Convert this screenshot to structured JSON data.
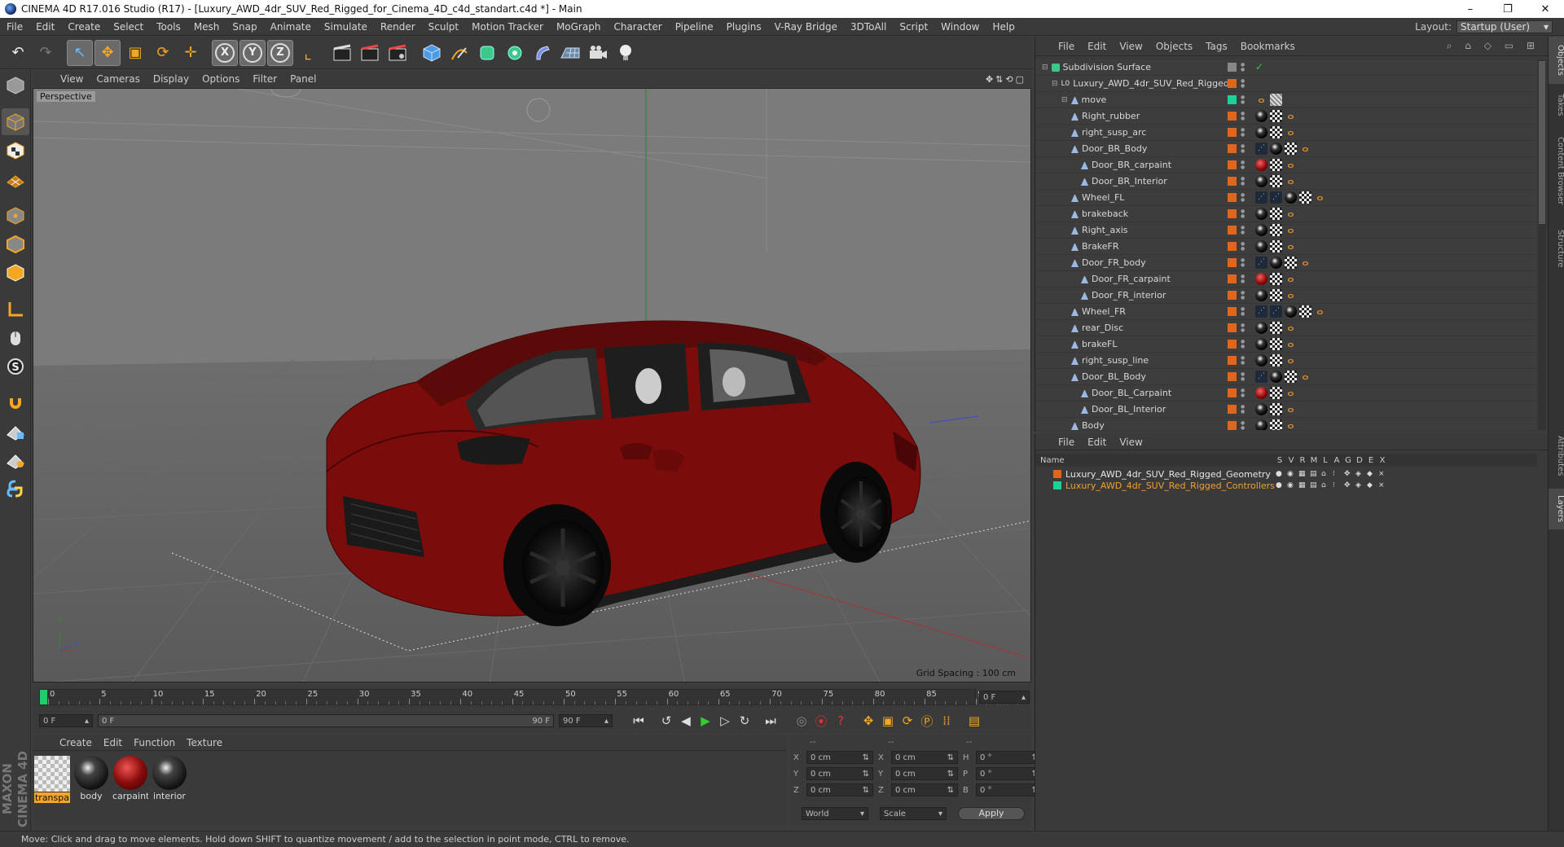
{
  "window": {
    "title": "CINEMA 4D R17.016 Studio (R17) - [Luxury_AWD_4dr_SUV_Red_Rigged_for_Cinema_4D_c4d_standart.c4d *] - Main",
    "min": "–",
    "max": "❐",
    "close": "✕"
  },
  "menu": {
    "items": [
      "File",
      "Edit",
      "Create",
      "Select",
      "Tools",
      "Mesh",
      "Snap",
      "Animate",
      "Simulate",
      "Render",
      "Sculpt",
      "Motion Tracker",
      "MoGraph",
      "Character",
      "Pipeline",
      "Plugins",
      "V-Ray Bridge",
      "3DToAll",
      "Script",
      "Window",
      "Help"
    ],
    "layout_label": "Layout:",
    "layout_value": "Startup (User)"
  },
  "toolbar": {
    "undo": "↶",
    "redo": "↷",
    "select": "↖",
    "move": "✥",
    "scale": "▣",
    "rotate": "⟳",
    "last": "✛",
    "x": "X",
    "y": "Y",
    "z": "Z",
    "coord": "⌞"
  },
  "viewport": {
    "menu": [
      "View",
      "Cameras",
      "Display",
      "Options",
      "Filter",
      "Panel"
    ],
    "nav_icons": "✥⇅⟲▢",
    "label": "Perspective",
    "grid_spacing": "Grid Spacing : 100 cm",
    "axis_y": "y",
    "axis_z": "z",
    "colors": {
      "car": "#7a0d0b",
      "bg": "#7a7a7a",
      "floor": "#5e5e5e"
    }
  },
  "timeline": {
    "ticks": [
      "0",
      "5",
      "10",
      "15",
      "20",
      "25",
      "30",
      "35",
      "40",
      "45",
      "50",
      "55",
      "60",
      "65",
      "70",
      "75",
      "80",
      "85",
      "90"
    ],
    "end_frame": "0 F",
    "current": "0 F",
    "range_start": "0 F",
    "range_end": "90 F",
    "max": "90 F"
  },
  "materials": {
    "menu": [
      "Create",
      "Edit",
      "Function",
      "Texture"
    ],
    "items": [
      {
        "label": "transpa",
        "kind": "checker"
      },
      {
        "label": "body",
        "kind": "dark"
      },
      {
        "label": "carpaint",
        "kind": "red"
      },
      {
        "label": "interior",
        "kind": "dark"
      }
    ]
  },
  "coords": {
    "header": [
      "--",
      "--",
      "--"
    ],
    "rows": [
      {
        "a": "X",
        "av": "0 cm",
        "b": "X",
        "bv": "0 cm",
        "c": "H",
        "cv": "0 °"
      },
      {
        "a": "Y",
        "av": "0 cm",
        "b": "Y",
        "bv": "0 cm",
        "c": "P",
        "cv": "0 °"
      },
      {
        "a": "Z",
        "av": "0 cm",
        "b": "Z",
        "bv": "0 cm",
        "c": "B",
        "cv": "0 °"
      }
    ],
    "mode1": "World",
    "mode2": "Scale",
    "apply": "Apply"
  },
  "objects": {
    "menu": [
      "File",
      "Edit",
      "View",
      "Objects",
      "Tags",
      "Bookmarks"
    ],
    "rows": [
      {
        "name": "Subdivision Surface",
        "depth": 0,
        "layer": "#888",
        "tags": [
          "check"
        ]
      },
      {
        "name": "Luxury_AWD_4dr_SUV_Red_Rigged",
        "depth": 1,
        "layer": "#e0661e",
        "tags": []
      },
      {
        "name": "move",
        "depth": 2,
        "layer": "#1ecf9a",
        "tags": [
          "bone",
          "chk2"
        ]
      },
      {
        "name": "Right_rubber",
        "depth": 3,
        "layer": "#e0661e",
        "tags": [
          "ball",
          "chk",
          "bone"
        ]
      },
      {
        "name": "right_susp_arc",
        "depth": 3,
        "layer": "#e0661e",
        "tags": [
          "ball",
          "chk",
          "bone"
        ]
      },
      {
        "name": "Door_BR_Body",
        "depth": 3,
        "layer": "#e0661e",
        "tags": [
          "blue",
          "ball",
          "chk",
          "bone"
        ]
      },
      {
        "name": "Door_BR_carpaint",
        "depth": 4,
        "layer": "#e0661e",
        "tags": [
          "red",
          "chk",
          "bone"
        ]
      },
      {
        "name": "Door_BR_Interior",
        "depth": 4,
        "layer": "#e0661e",
        "tags": [
          "ball",
          "chk",
          "bone"
        ]
      },
      {
        "name": "Wheel_FL",
        "depth": 3,
        "layer": "#e0661e",
        "tags": [
          "blue",
          "blue",
          "ball",
          "chk",
          "bone"
        ]
      },
      {
        "name": "brakeback",
        "depth": 3,
        "layer": "#e0661e",
        "tags": [
          "ball",
          "chk",
          "bone"
        ]
      },
      {
        "name": "Right_axis",
        "depth": 3,
        "layer": "#e0661e",
        "tags": [
          "ball",
          "chk",
          "bone"
        ]
      },
      {
        "name": "BrakeFR",
        "depth": 3,
        "layer": "#e0661e",
        "tags": [
          "ball",
          "chk",
          "bone"
        ]
      },
      {
        "name": "Door_FR_body",
        "depth": 3,
        "layer": "#e0661e",
        "tags": [
          "blue",
          "ball",
          "chk",
          "bone"
        ]
      },
      {
        "name": "Door_FR_carpaint",
        "depth": 4,
        "layer": "#e0661e",
        "tags": [
          "red",
          "chk",
          "bone"
        ]
      },
      {
        "name": "Door_FR_interior",
        "depth": 4,
        "layer": "#e0661e",
        "tags": [
          "ball",
          "chk",
          "bone"
        ]
      },
      {
        "name": "Wheel_FR",
        "depth": 3,
        "layer": "#e0661e",
        "tags": [
          "blue",
          "blue",
          "ball",
          "chk",
          "bone"
        ]
      },
      {
        "name": "rear_Disc",
        "depth": 3,
        "layer": "#e0661e",
        "tags": [
          "ball",
          "chk",
          "bone"
        ]
      },
      {
        "name": "brakeFL",
        "depth": 3,
        "layer": "#e0661e",
        "tags": [
          "ball",
          "chk",
          "bone"
        ]
      },
      {
        "name": "right_susp_line",
        "depth": 3,
        "layer": "#e0661e",
        "tags": [
          "ball",
          "chk",
          "bone"
        ]
      },
      {
        "name": "Door_BL_Body",
        "depth": 3,
        "layer": "#e0661e",
        "tags": [
          "blue",
          "ball",
          "chk",
          "bone"
        ]
      },
      {
        "name": "Door_BL_Carpaint",
        "depth": 4,
        "layer": "#e0661e",
        "tags": [
          "red",
          "chk",
          "bone"
        ]
      },
      {
        "name": "Door_BL_Interior",
        "depth": 4,
        "layer": "#e0661e",
        "tags": [
          "ball",
          "chk",
          "bone"
        ]
      },
      {
        "name": "Body",
        "depth": 3,
        "layer": "#e0661e",
        "tags": [
          "ball",
          "chk",
          "bone"
        ]
      }
    ]
  },
  "layers": {
    "menu": [
      "File",
      "Edit",
      "View"
    ],
    "header": {
      "name": "Name",
      "cols": [
        "S",
        "V",
        "R",
        "M",
        "L",
        "A",
        "G",
        "D",
        "E",
        "X"
      ]
    },
    "rows": [
      {
        "name": "Luxury_AWD_4dr_SUV_Red_Rigged_Geometry",
        "color": "#e0661e",
        "text": "#e6e6e6"
      },
      {
        "name": "Luxury_AWD_4dr_SUV_Red_Rigged_Controllers",
        "color": "#1ecf9a",
        "text": "#f0a030"
      }
    ]
  },
  "sidetabs": [
    "Objects",
    "Takes",
    "Content Browser",
    "Structure",
    "Attributes",
    "Layers"
  ],
  "status": "Move: Click and drag to move elements. Hold down SHIFT to quantize movement / add to the selection in point mode, CTRL to remove.",
  "brand": "MAXON CINEMA 4D"
}
